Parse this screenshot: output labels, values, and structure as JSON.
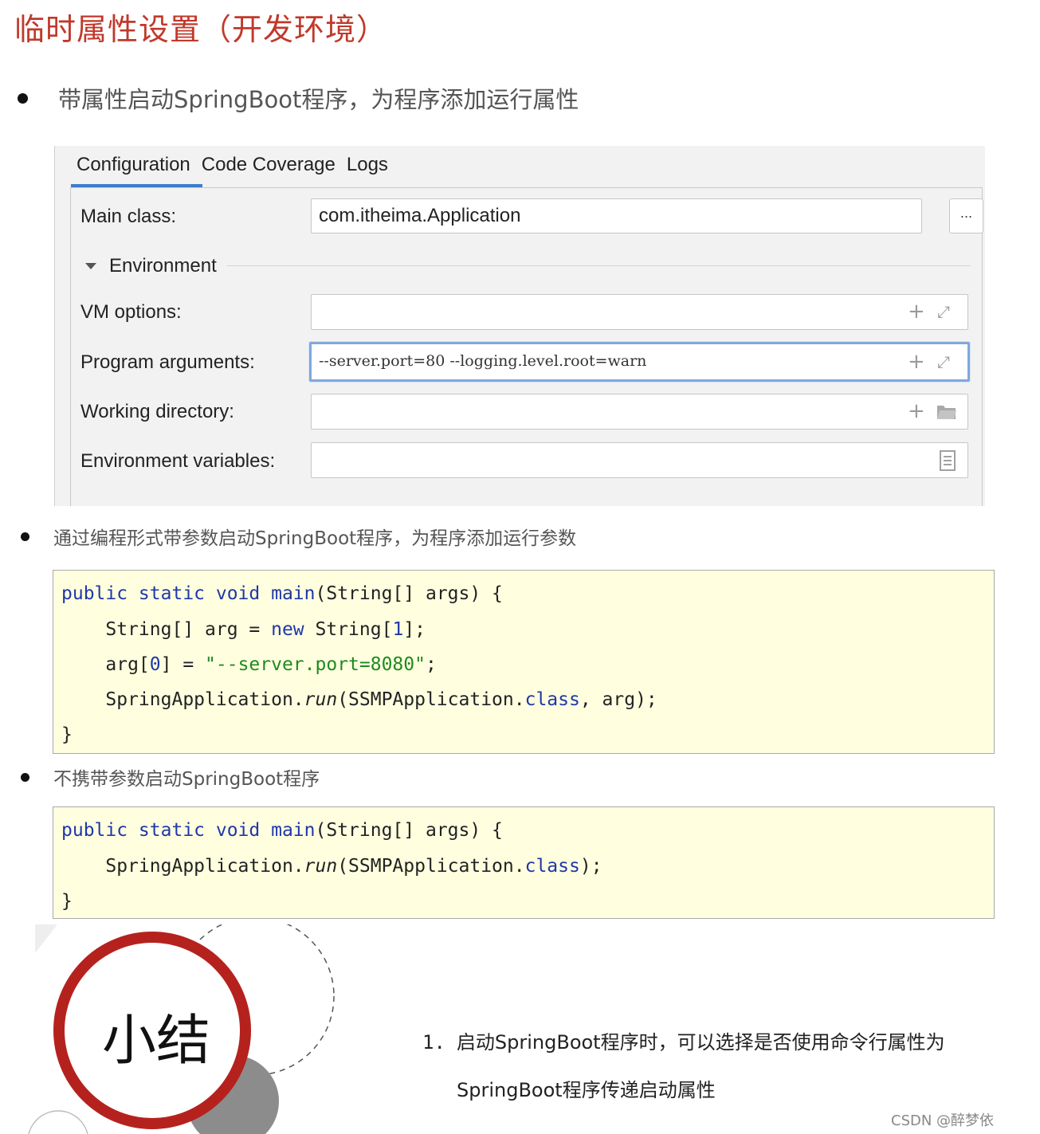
{
  "title": "临时属性设置（开发环境）",
  "bullets": [
    "带属性启动SpringBoot程序，为程序添加运行属性",
    "通过编程形式带参数启动SpringBoot程序，为程序添加运行参数",
    "不携带参数启动SpringBoot程序"
  ],
  "ide": {
    "tabs": [
      "Configuration",
      "Code Coverage",
      "Logs"
    ],
    "active_tab": "Configuration",
    "main_class_label": "Main class:",
    "main_class_value": "com.itheima.Application",
    "browse_label": "...",
    "environment_label": "Environment",
    "vm_options_label": "VM options:",
    "vm_options_value": "",
    "program_arguments_label": "Program arguments:",
    "program_arguments_value": "--server.port=80 --logging.level.root=warn",
    "working_directory_label": "Working directory:",
    "working_directory_value": "",
    "environment_variables_label": "Environment variables:",
    "environment_variables_value": "",
    "icons": [
      "plus-icon",
      "expand-icon",
      "folder-icon",
      "document-icon"
    ],
    "accent_color": "#3d7dca"
  },
  "code_block_1": {
    "lines": [
      "public static void main(String[] args) {",
      "    String[] arg = new String[1];",
      "    arg[0] = \"--server.port=8080\";",
      "    SpringApplication.run(SSMPApplication.class, arg);",
      "}"
    ]
  },
  "code_block_2": {
    "lines": [
      "public static void main(String[] args) {",
      "    SpringApplication.run(SSMPApplication.class);",
      "}"
    ]
  },
  "summary": {
    "title": "小结",
    "item_number": "1.",
    "item_line_1": "启动SpringBoot程序时，可以选择是否使用命令行属性为",
    "item_line_2": "SpringBoot程序传递启动属性"
  },
  "watermark": "CSDN @醉梦依",
  "colors": {
    "title": "#c0392b",
    "keyword": "#1f38a8",
    "string": "#1f8a1f",
    "code_background": "#ffffe0",
    "circle_red": "#b5221e"
  }
}
